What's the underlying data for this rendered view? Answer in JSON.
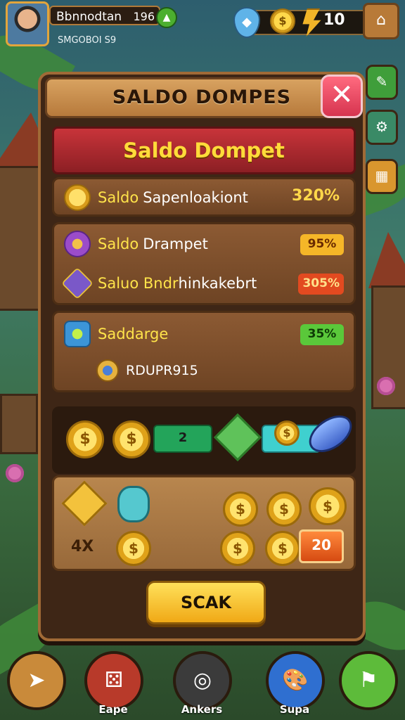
{
  "player": {
    "name": "Bbnnodtan",
    "level": "196",
    "subtitle": "SMGOBOI S9"
  },
  "resources": {
    "gems": "",
    "energy_value": "10"
  },
  "panel": {
    "header": "SALDO DOMPES",
    "close_symbol": "✕",
    "banner": "Saldo Dompet"
  },
  "balance_row": {
    "prefix": "Saldo",
    "label": "Sapenloakiont",
    "percent": "320%"
  },
  "group_rows": [
    {
      "prefix": "Saldo",
      "label": "Drampet",
      "percent": "95%",
      "color": "#f5b628"
    },
    {
      "prefix": "Saluo Bndr",
      "label": "hinkakebrt",
      "percent": "305%",
      "color": "#e24a20"
    }
  ],
  "third_box": {
    "label": "Saddarge",
    "percent": "35%",
    "sub_label": "RDUPR915",
    "color": "#5ac83a"
  },
  "conversion": {
    "bar_value": "2"
  },
  "rewards": {
    "multiplier": "4X",
    "count": "20"
  },
  "scan_button": "SCAK",
  "bottom_nav": [
    {
      "label": "",
      "icon": "arrow-icon"
    },
    {
      "label": "Eape",
      "icon": "dice-icon"
    },
    {
      "label": "Ankers",
      "icon": "ring-icon"
    },
    {
      "label": "Supa",
      "icon": "palette-icon"
    },
    {
      "label": "",
      "icon": "flag-icon"
    }
  ],
  "colors": {
    "panel_bg": "#3e2616",
    "banner_red": "#c8343a",
    "gold": "#ffd84a",
    "close_pink": "#ff6a7f"
  }
}
